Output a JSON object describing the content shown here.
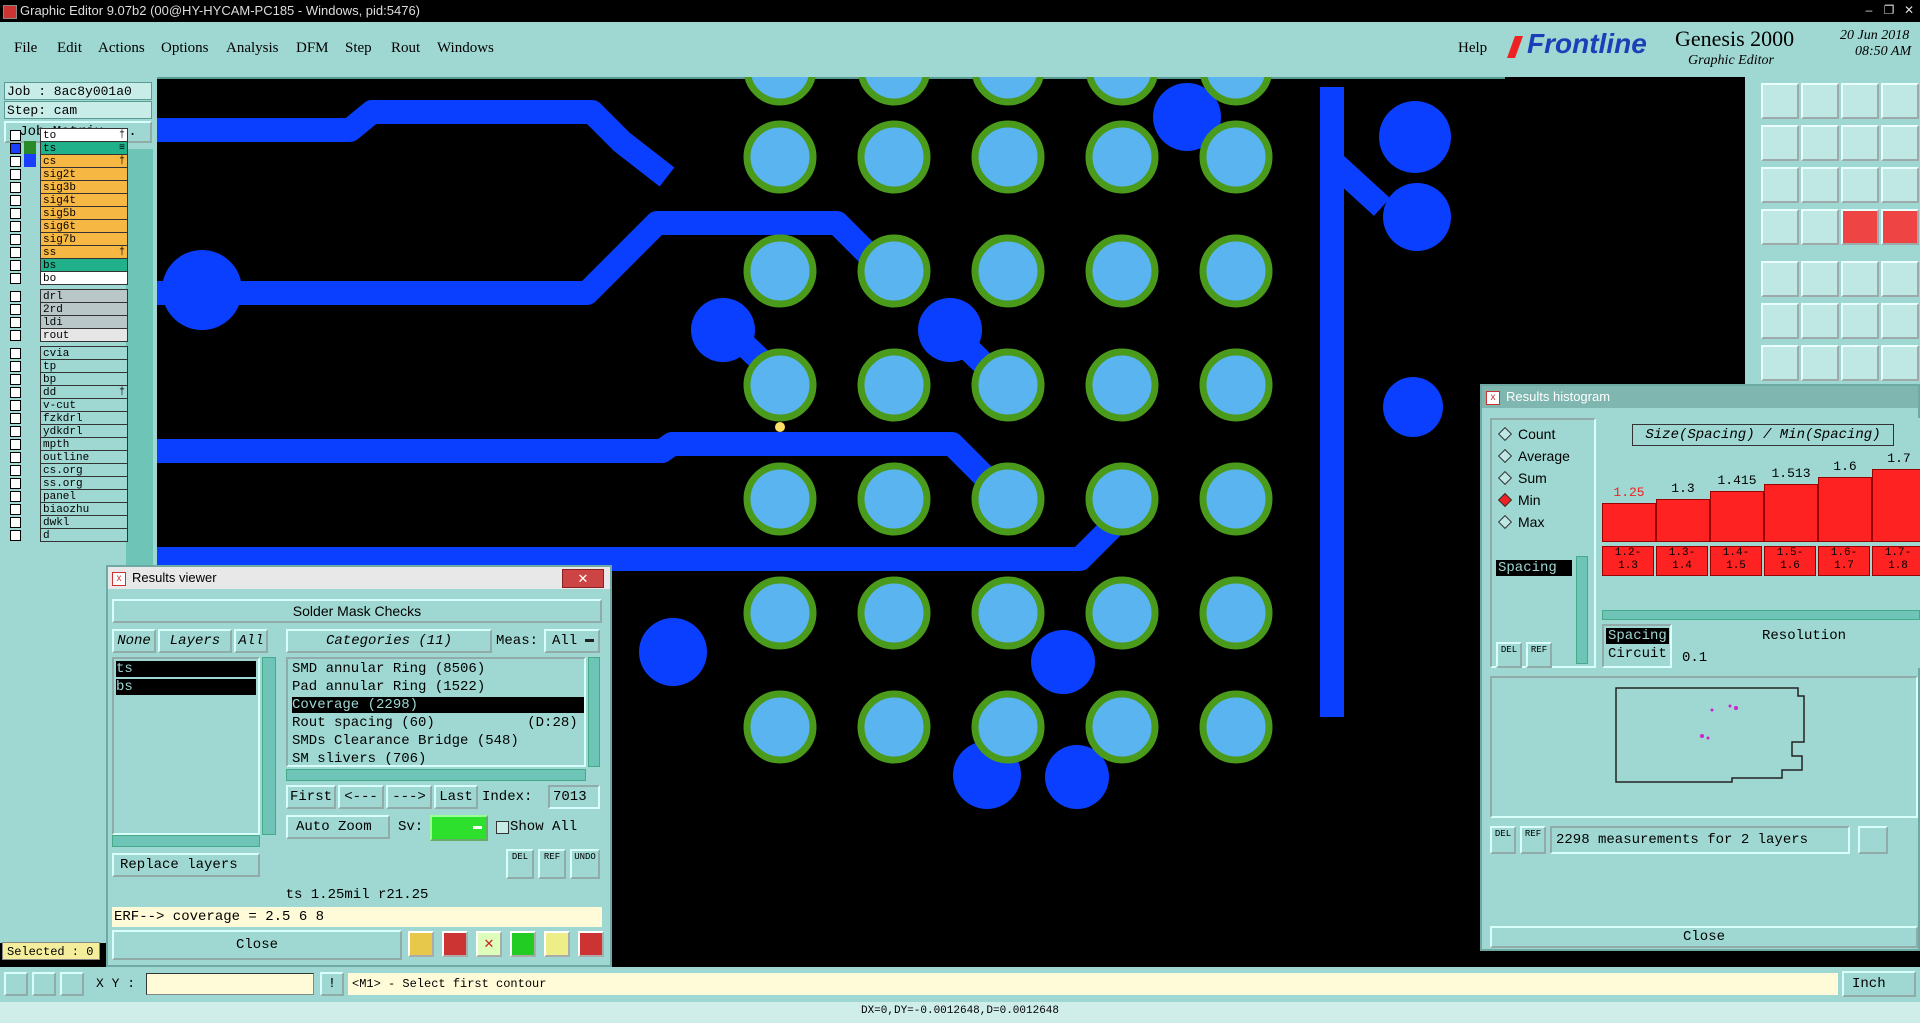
{
  "window": {
    "title": "Graphic Editor 9.07b2 (00@HY-HYCAM-PC185 - Windows, pid:5476)"
  },
  "menu": {
    "items": [
      "File",
      "Edit",
      "Actions",
      "Options",
      "Analysis",
      "DFM",
      "Step",
      "Rout",
      "Windows"
    ],
    "help": "Help"
  },
  "brand": {
    "logo": "Frontline",
    "product": "Genesis 2000",
    "subtitle": "Graphic Editor",
    "date": "20 Jun 2018",
    "time": "08:50 AM"
  },
  "job": {
    "job_line": "Job : 8ac8y001a0",
    "step_line": "Step: cam",
    "matrix_button": "Job Matrix ..."
  },
  "layers": [
    {
      "name": "to",
      "color": "#ffffff",
      "mark": "†"
    },
    {
      "name": "ts",
      "color": "#20b08a",
      "mark": "≡"
    },
    {
      "name": "cs",
      "color": "#f6b843",
      "mark": "†"
    },
    {
      "name": "sig2t",
      "color": "#f6b843",
      "mark": ""
    },
    {
      "name": "sig3b",
      "color": "#f6b843",
      "mark": ""
    },
    {
      "name": "sig4t",
      "color": "#f6b843",
      "mark": ""
    },
    {
      "name": "sig5b",
      "color": "#f6b843",
      "mark": ""
    },
    {
      "name": "sig6t",
      "color": "#f6b843",
      "mark": ""
    },
    {
      "name": "sig7b",
      "color": "#f6b843",
      "mark": ""
    },
    {
      "name": "ss",
      "color": "#f6b843",
      "mark": "†"
    },
    {
      "name": "bs",
      "color": "#20b08a",
      "mark": ""
    },
    {
      "name": "bo",
      "color": "#ffffff",
      "mark": ""
    },
    {
      "name": "drl",
      "color": "#b9c7c9",
      "mark": ""
    },
    {
      "name": "2rd",
      "color": "#b9c7c9",
      "mark": ""
    },
    {
      "name": "ldi",
      "color": "#b9c7c9",
      "mark": ""
    },
    {
      "name": "rout",
      "color": "#e6e6e6",
      "mark": ""
    },
    {
      "name": "cvia",
      "color": "#9fd8d2",
      "mark": ""
    },
    {
      "name": "tp",
      "color": "#9fd8d2",
      "mark": ""
    },
    {
      "name": "bp",
      "color": "#9fd8d2",
      "mark": ""
    },
    {
      "name": "dd",
      "color": "#9fd8d2",
      "mark": "†"
    },
    {
      "name": "v-cut",
      "color": "#9fd8d2",
      "mark": ""
    },
    {
      "name": "fzkdrl",
      "color": "#9fd8d2",
      "mark": ""
    },
    {
      "name": "ydkdrl",
      "color": "#9fd8d2",
      "mark": ""
    },
    {
      "name": "mpth",
      "color": "#9fd8d2",
      "mark": ""
    },
    {
      "name": "outline",
      "color": "#9fd8d2",
      "mark": ""
    },
    {
      "name": "cs.org",
      "color": "#9fd8d2",
      "mark": ""
    },
    {
      "name": "ss.org",
      "color": "#9fd8d2",
      "mark": ""
    },
    {
      "name": "panel",
      "color": "#9fd8d2",
      "mark": ""
    },
    {
      "name": "biaozhu",
      "color": "#9fd8d2",
      "mark": ""
    },
    {
      "name": "dwkl",
      "color": "#9fd8d2",
      "mark": ""
    },
    {
      "name": "d",
      "color": "#9fd8d2",
      "mark": ""
    }
  ],
  "selected": "Selected : 0",
  "results_viewer": {
    "title": "Results viewer",
    "header": "Solder Mask Checks",
    "none_btn": "None",
    "layers_btn": "Layers",
    "all_btn": "All",
    "categories_btn": "Categories (11)",
    "meas_label": "Meas:",
    "meas_value": "All",
    "layer_list": [
      "ts",
      "bs"
    ],
    "categories": [
      "SMD annular Ring (8506)",
      "Pad annular Ring (1522)",
      "Coverage (2298)",
      "Rout spacing (60)           (D:28)",
      "SMDs Clearance Bridge (548)",
      "SM slivers (706)"
    ],
    "selected_category": "Coverage (2298)",
    "first": "First",
    "prev": "<---",
    "next": "--->",
    "last": "Last",
    "index_label": "Index:",
    "index_value": "7013",
    "auto_zoom": "Auto Zoom",
    "sv_label": "Sv:",
    "show_all": "Show All",
    "replace_layers": "Replace layers",
    "small_btns": [
      "DEL",
      "REF",
      "UNDO"
    ],
    "measure_line": "ts 1.25mil  r21.25",
    "erf_line": "ERF--> coverage = 2.5 6 8",
    "close": "Close"
  },
  "histogram": {
    "title": "Results histogram",
    "options": [
      "Count",
      "Average",
      "Sum",
      "Min",
      "Max"
    ],
    "selected_option": "Min",
    "list": [
      "Spacing"
    ],
    "header": "Size(Spacing) / Min(Spacing)",
    "bars": [
      1.25,
      1.3,
      1.415,
      1.513,
      1.6,
      1.7
    ],
    "bar_labels": [
      "1.25",
      "1.3",
      "1.415",
      "1.513",
      "1.6",
      "1.7"
    ],
    "bin_labels": [
      [
        "1.2-",
        "1.3"
      ],
      [
        "1.3-",
        "1.4"
      ],
      [
        "1.4-",
        "1.5"
      ],
      [
        "1.5-",
        "1.6"
      ],
      [
        "1.6-",
        "1.7"
      ],
      [
        "1.7-",
        "1.8"
      ]
    ],
    "size_list": [
      "Spacing",
      "Circuit"
    ],
    "resolution_label": "Resolution",
    "resolution_value": "0.1",
    "summary": "2298 measurements for 2 layers",
    "small_btns": [
      "DEL",
      "REF"
    ],
    "close": "Close"
  },
  "status": {
    "xy_label": "X Y :",
    "xy_value": "",
    "prompt": "<M1> - Select first contour",
    "units": "Inch",
    "coords": "DX=0,DY=-0.0012648,D=0.0012648"
  },
  "colors": {
    "panel": "#9fd8d2",
    "trace": "#0a3fff",
    "pad": "#5ab4f0",
    "mask_ring": "#4a9a1c",
    "bar": "#f22222"
  }
}
